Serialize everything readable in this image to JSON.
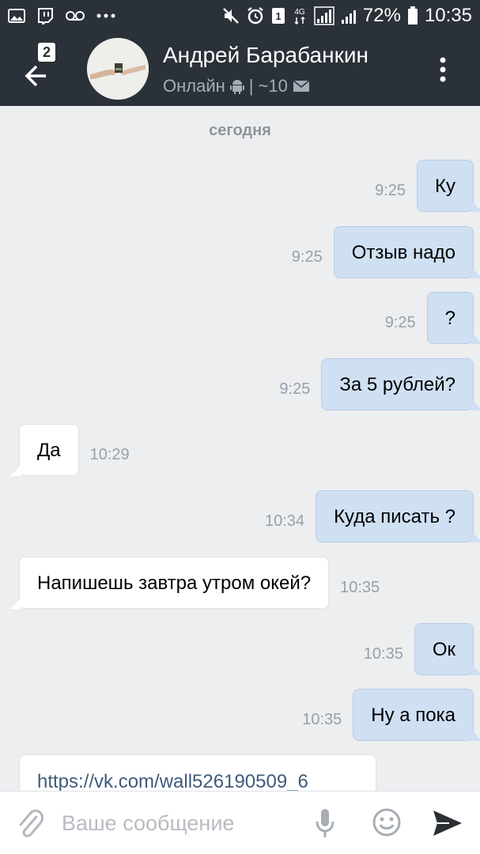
{
  "status_bar": {
    "battery_text": "72%",
    "time": "10:35",
    "sim_badge": "1",
    "network_label": "4G",
    "icons": [
      "gallery-icon",
      "twitch-icon",
      "voicemail-icon",
      "more-notifications-icon",
      "mute-icon",
      "alarm-icon",
      "sim-icon",
      "network-4g-icon",
      "signal-icon",
      "signal-2-icon",
      "battery-icon"
    ]
  },
  "header": {
    "back_badge": "2",
    "contact_name": "Андрей Барабанкин",
    "status_text": "Онлайн",
    "separator": "|",
    "unread_text": "~10",
    "icons": [
      "back-arrow-icon",
      "android-icon",
      "mail-icon",
      "more-vert-icon"
    ]
  },
  "chat": {
    "day_separator": "сегодня",
    "messages": [
      {
        "direction": "out",
        "text": "Ку",
        "time": "9:25"
      },
      {
        "direction": "out",
        "text": "Отзыв надо",
        "time": "9:25"
      },
      {
        "direction": "out",
        "text": "?",
        "time": "9:25"
      },
      {
        "direction": "out",
        "text": "За 5 рублей?",
        "time": "9:25"
      },
      {
        "direction": "in",
        "text": "Да",
        "time": "10:29"
      },
      {
        "direction": "out",
        "text": "Куда писать ?",
        "time": "10:34"
      },
      {
        "direction": "in",
        "text": "Напишешь завтра утром окей?",
        "time": "10:35"
      },
      {
        "direction": "out",
        "text": "Ок",
        "time": "10:35"
      },
      {
        "direction": "out",
        "text": "Ну а пока",
        "time": "10:35"
      }
    ],
    "partial_message": {
      "direction": "in",
      "text": "https://vk.com/wall526190509_6"
    }
  },
  "input_bar": {
    "placeholder": "Ваше сообщение",
    "icons": [
      "attach-icon",
      "mic-icon",
      "emoji-icon",
      "send-icon"
    ]
  },
  "colors": {
    "header_bg": "#2b3139",
    "chat_bg": "#edeef0",
    "outgoing_bubble": "#cfe0f3",
    "incoming_bubble": "#ffffff",
    "time_text": "#96a0aa",
    "link_text": "#3f5a7c"
  }
}
